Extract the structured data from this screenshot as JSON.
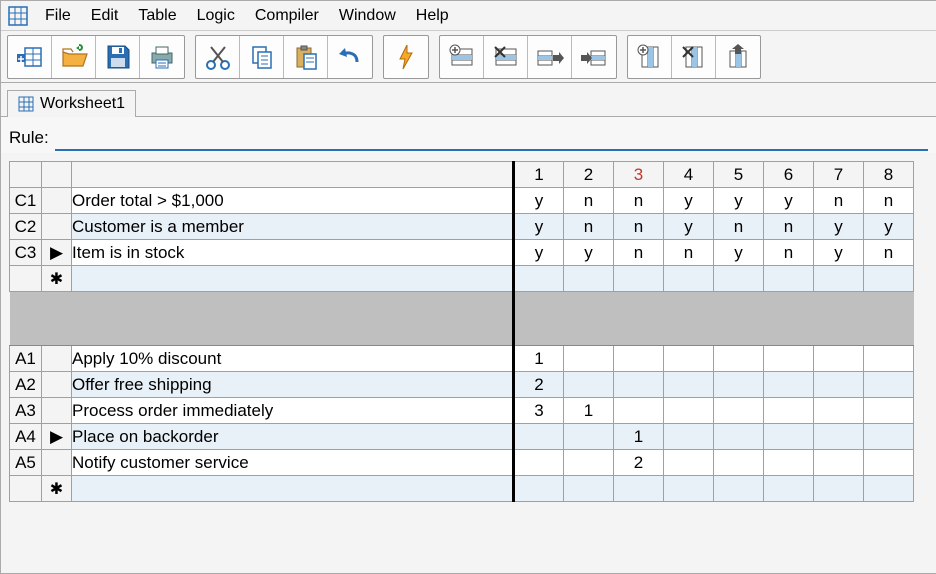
{
  "menu": {
    "items": [
      "File",
      "Edit",
      "Table",
      "Logic",
      "Compiler",
      "Window",
      "Help"
    ]
  },
  "tabs": {
    "active": "Worksheet1"
  },
  "rule": {
    "label": "Rule:",
    "value": ""
  },
  "headers": [
    "1",
    "2",
    "3",
    "4",
    "5",
    "6",
    "7",
    "8"
  ],
  "conditions": [
    {
      "id": "C1",
      "mark": "",
      "text": "Order total > $1,000",
      "vals": [
        "y",
        "n",
        "n",
        "y",
        "y",
        "y",
        "n",
        "n"
      ]
    },
    {
      "id": "C2",
      "mark": "",
      "text": "Customer is a member",
      "vals": [
        "y",
        "n",
        "n",
        "y",
        "n",
        "n",
        "y",
        "y"
      ]
    },
    {
      "id": "C3",
      "mark": "▶",
      "text": "Item is in stock",
      "vals": [
        "y",
        "y",
        "n",
        "n",
        "y",
        "n",
        "y",
        "n"
      ]
    }
  ],
  "cond_blank_mark": "✱",
  "actions": [
    {
      "id": "A1",
      "mark": "",
      "text": "Apply 10% discount",
      "vals": [
        "1",
        "",
        "",
        "",
        "",
        "",
        "",
        ""
      ]
    },
    {
      "id": "A2",
      "mark": "",
      "text": "Offer free shipping",
      "vals": [
        "2",
        "",
        "",
        "",
        "",
        "",
        "",
        ""
      ]
    },
    {
      "id": "A3",
      "mark": "",
      "text": "Process order immediately",
      "vals": [
        "3",
        "1",
        "",
        "",
        "",
        "",
        "",
        ""
      ]
    },
    {
      "id": "A4",
      "mark": "▶",
      "text": "Place on backorder",
      "vals": [
        "",
        "",
        "1",
        "",
        "",
        "",
        "",
        ""
      ]
    },
    {
      "id": "A5",
      "mark": "",
      "text": "Notify customer service",
      "vals": [
        "",
        "",
        "2",
        "",
        "",
        "",
        "",
        ""
      ]
    }
  ],
  "act_blank_mark": "✱"
}
